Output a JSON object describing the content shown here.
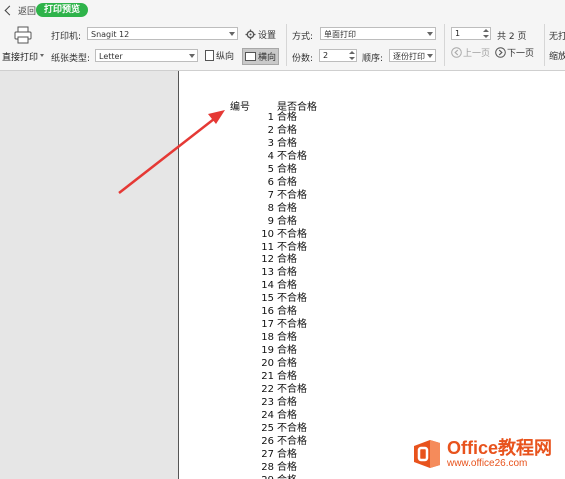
{
  "topbar": {
    "back_label": "返回",
    "tab_label": "打印预览"
  },
  "ribbon": {
    "print_direct_label": "直接打印",
    "printer_label": "打印机:",
    "printer_value": "Snagit 12",
    "settings_label": "设置",
    "paper_label": "纸张类型:",
    "paper_value": "Letter",
    "portrait_label": "纵向",
    "landscape_label": "横向",
    "mode_label": "方式:",
    "mode_value": "单面打印",
    "copies_label": "份数:",
    "copies_value": "2",
    "order_label": "顺序:",
    "order_value": "逐份打印",
    "page_value": "1",
    "total_pages": "共 2 页",
    "prev_label": "上一页",
    "next_label": "下一页",
    "cut_right_top": "无打",
    "cut_right_bottom": "缩放"
  },
  "table": {
    "col1_header": "编号",
    "col2_header": "是否合格",
    "rows": [
      {
        "n": "1",
        "v": "合格"
      },
      {
        "n": "2",
        "v": "合格"
      },
      {
        "n": "3",
        "v": "合格"
      },
      {
        "n": "4",
        "v": "不合格"
      },
      {
        "n": "5",
        "v": "合格"
      },
      {
        "n": "6",
        "v": "合格"
      },
      {
        "n": "7",
        "v": "不合格"
      },
      {
        "n": "8",
        "v": "合格"
      },
      {
        "n": "9",
        "v": "合格"
      },
      {
        "n": "10",
        "v": "不合格"
      },
      {
        "n": "11",
        "v": "不合格"
      },
      {
        "n": "12",
        "v": "合格"
      },
      {
        "n": "13",
        "v": "合格"
      },
      {
        "n": "14",
        "v": "合格"
      },
      {
        "n": "15",
        "v": "不合格"
      },
      {
        "n": "16",
        "v": "合格"
      },
      {
        "n": "17",
        "v": "不合格"
      },
      {
        "n": "18",
        "v": "合格"
      },
      {
        "n": "19",
        "v": "合格"
      },
      {
        "n": "20",
        "v": "合格"
      },
      {
        "n": "21",
        "v": "合格"
      },
      {
        "n": "22",
        "v": "不合格"
      },
      {
        "n": "23",
        "v": "合格"
      },
      {
        "n": "24",
        "v": "合格"
      },
      {
        "n": "25",
        "v": "不合格"
      },
      {
        "n": "26",
        "v": "不合格"
      },
      {
        "n": "27",
        "v": "合格"
      },
      {
        "n": "28",
        "v": "合格"
      },
      {
        "n": "29",
        "v": "合格"
      }
    ]
  },
  "watermark": {
    "brand": "Office教程网",
    "url": "www.office26.com"
  },
  "colors": {
    "accent_green": "#2eb34a",
    "arrow_red": "#e53935",
    "office_orange": "#e8531d"
  },
  "icons": {
    "print": "printer-icon",
    "settings": "gear-icon",
    "portrait": "portrait-icon",
    "landscape": "landscape-icon",
    "prev": "arrow-left-circle-icon",
    "next": "arrow-right-circle-icon"
  }
}
